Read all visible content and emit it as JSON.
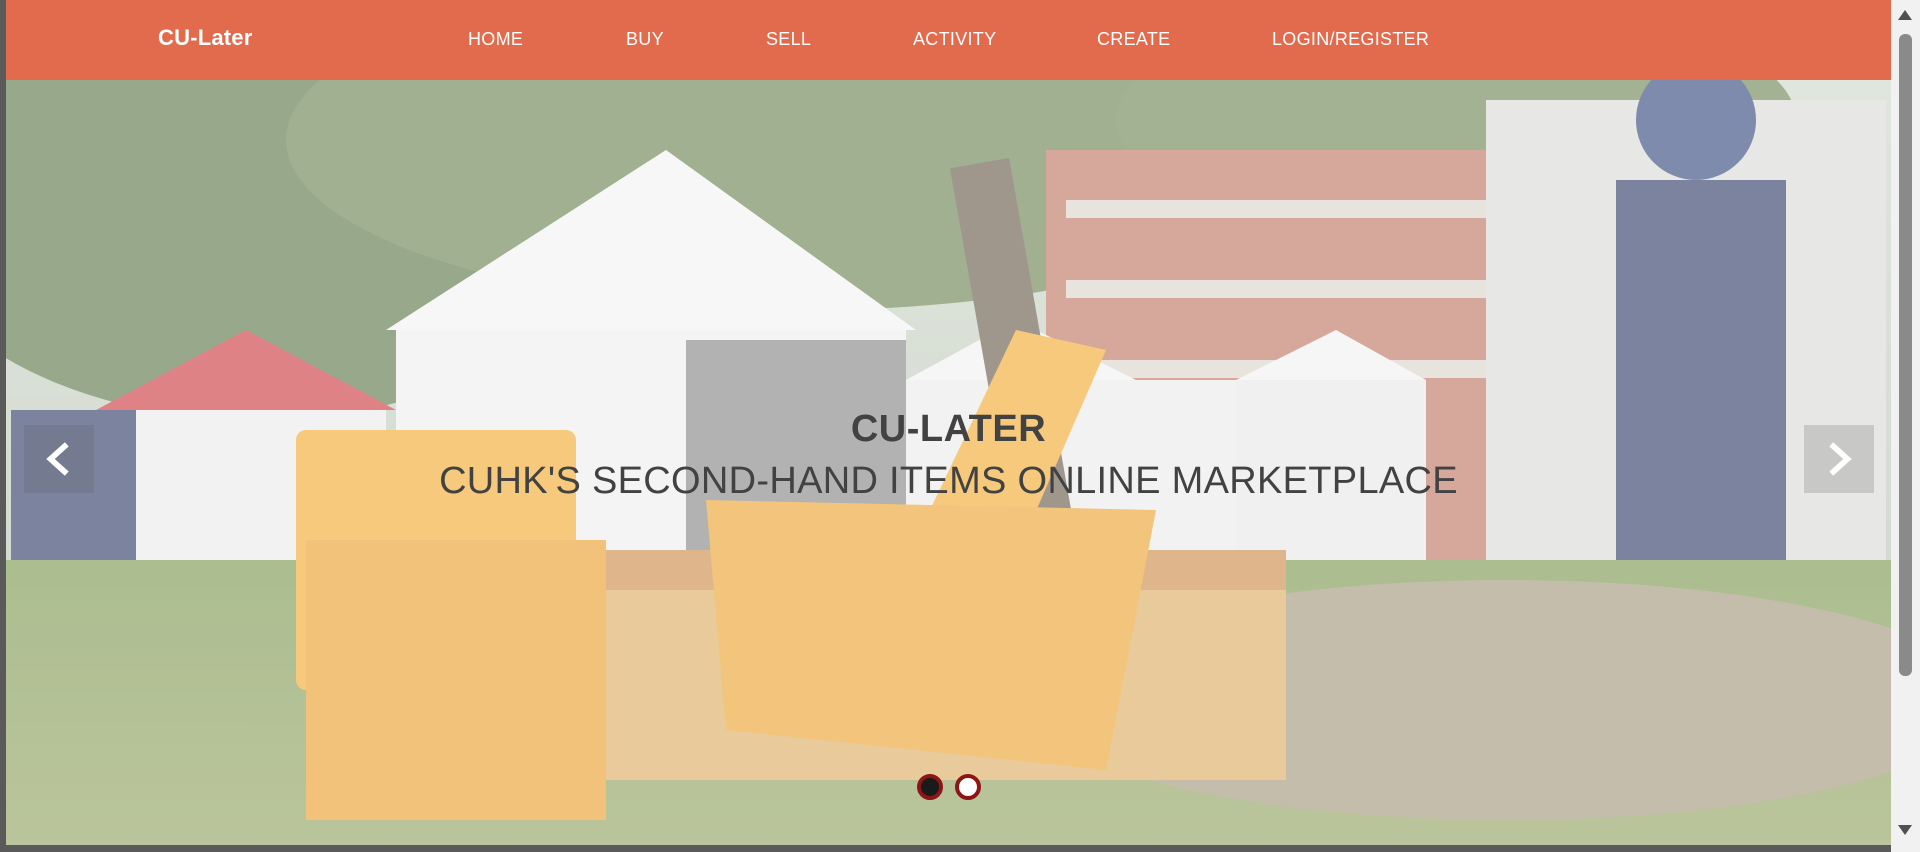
{
  "navbar": {
    "brand": "CU-Later",
    "items": [
      {
        "label": "HOME"
      },
      {
        "label": "BUY"
      },
      {
        "label": "SELL"
      },
      {
        "label": "ACTIVITY"
      },
      {
        "label": "CREATE"
      },
      {
        "label": "LOGIN/REGISTER"
      }
    ],
    "accent": "#e26b4d"
  },
  "hero": {
    "title": "CU-LATER",
    "subtitle": "CUHK'S SECOND-HAND ITEMS ONLINE MARKETPLACE",
    "prev_icon": "chevron-left-icon",
    "next_icon": "chevron-right-icon",
    "slide_count": 2,
    "active_slide": 1,
    "dot_color": "#8d1515"
  }
}
